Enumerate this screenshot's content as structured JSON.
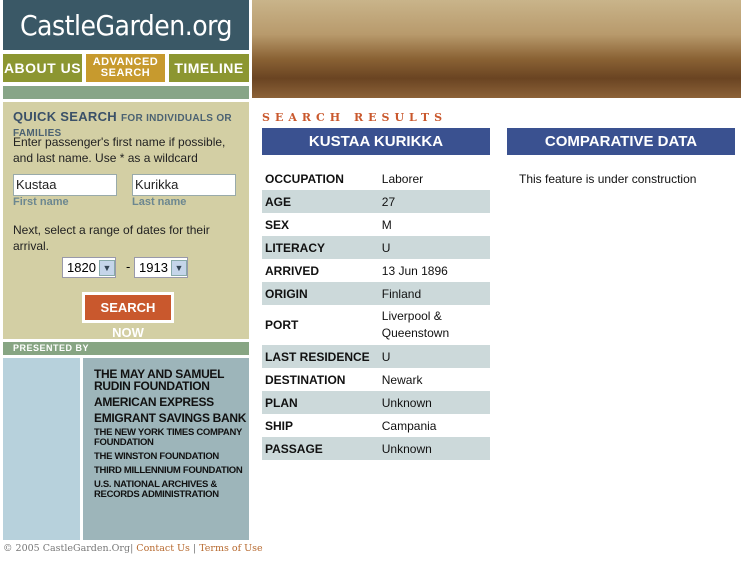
{
  "site": {
    "logo": "CastleGarden.org"
  },
  "nav": [
    {
      "label": "ABOUT US",
      "color": "#8c9631"
    },
    {
      "label": "ADVANCED SEARCH",
      "color": "#c79a2e"
    },
    {
      "label": "TIMELINE",
      "color": "#8c9631"
    }
  ],
  "quick_search": {
    "title": "QUICK SEARCH",
    "subtitle": "FOR INDIVIDUALS OR FAMILIES",
    "instructions": "Enter passenger's first name if possible, and last name. Use * as a wildcard",
    "first_name_value": "Kustaa",
    "first_name_label": "First name",
    "last_name_value": "Kurikka",
    "last_name_label": "Last name",
    "date_instructions": "Next, select a range of dates for their arrival.",
    "from_year": "1820",
    "separator": "-",
    "to_year": "1913",
    "button": "SEARCH NOW"
  },
  "presented_by": {
    "title": "PRESENTED BY",
    "sponsors": [
      "THE MAY AND SAMUEL RUDIN FOUNDATION",
      "AMERICAN EXPRESS",
      "EMIGRANT SAVINGS BANK",
      "THE NEW YORK TIMES COMPANY FOUNDATION",
      "THE WINSTON FOUNDATION",
      "THIRD MILLENNIUM FOUNDATION",
      "U.S. NATIONAL ARCHIVES & RECORDS ADMINISTRATION"
    ]
  },
  "footer": {
    "copyright": "© 2005 CastleGarden.Org",
    "contact": "Contact Us",
    "terms": "Terms of Use"
  },
  "results": {
    "heading": "SEARCH RESULTS",
    "name": "KUSTAA KURIKKA",
    "rows": [
      {
        "label": "OCCUPATION",
        "value": "Laborer"
      },
      {
        "label": "AGE",
        "value": "27"
      },
      {
        "label": "SEX",
        "value": "M"
      },
      {
        "label": "LITERACY",
        "value": "U"
      },
      {
        "label": "ARRIVED",
        "value": "13 Jun 1896"
      },
      {
        "label": "ORIGIN",
        "value": "Finland"
      },
      {
        "label": "PORT",
        "value": "Liverpool & Queenstown"
      },
      {
        "label": "LAST RESIDENCE",
        "value": "U"
      },
      {
        "label": "DESTINATION",
        "value": "Newark"
      },
      {
        "label": "PLAN",
        "value": "Unknown"
      },
      {
        "label": "SHIP",
        "value": "Campania"
      },
      {
        "label": "PASSAGE",
        "value": "Unknown"
      }
    ]
  },
  "comparative": {
    "title": "COMPARATIVE DATA",
    "message": "This feature is under construction"
  }
}
